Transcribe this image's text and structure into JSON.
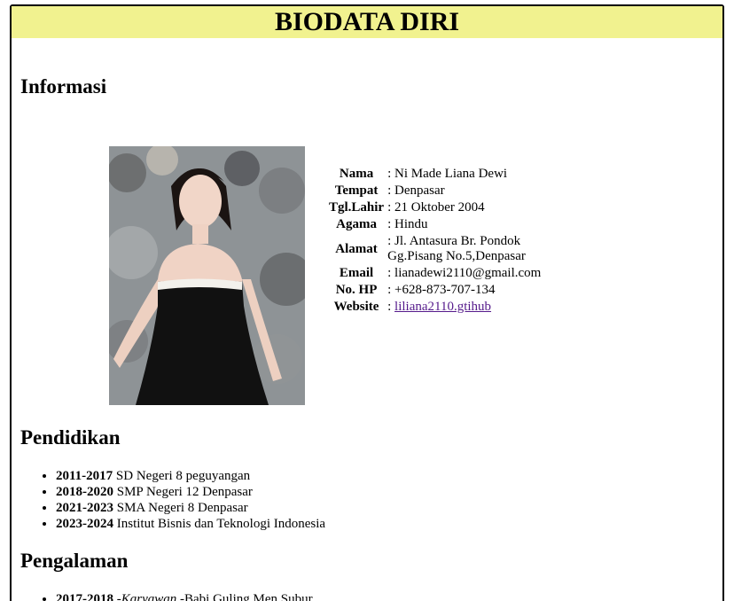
{
  "page": {
    "title": "BIODATA DIRI"
  },
  "sections": {
    "informasi": "Informasi",
    "pendidikan": "Pendidikan",
    "pengalaman": "Pengalaman"
  },
  "profile": {
    "rows": [
      {
        "key": "Nama",
        "value": ": Ni Made Liana Dewi"
      },
      {
        "key": "Tempat",
        "value": ": Denpasar"
      },
      {
        "key": "Tgl.Lahir",
        "value": ": 21 Oktober 2004"
      },
      {
        "key": "Agama",
        "value": ": Hindu"
      },
      {
        "key": "Alamat",
        "value": ": Jl. Antasura Br. Pondok Gg.Pisang No.5,Denpasar"
      },
      {
        "key": "Email",
        "value": ": lianadewi2110@gmail.com"
      },
      {
        "key": "No. HP",
        "value": ": +628-873-707-134"
      },
      {
        "key": "Website",
        "prefix": ": ",
        "link": "liliana2110.gtihub"
      }
    ]
  },
  "education": [
    {
      "years": "2011-2017",
      "text": " SD Negeri 8 peguyangan"
    },
    {
      "years": "2018-2020",
      "text": " SMP Negeri 12 Denpasar"
    },
    {
      "years": "2021-2023",
      "text": " SMA Negeri 8 Denpasar"
    },
    {
      "years": "2023-2024",
      "text": " Institut Bisnis dan Teknologi Indonesia"
    }
  ],
  "experience": [
    {
      "years": "2017-2018",
      "sep": " -",
      "role": "Karyawan",
      "text": " -Babi Guling Men Subur"
    }
  ],
  "colors": {
    "header_bg": "#f1f28f",
    "link": "#551a8b"
  }
}
